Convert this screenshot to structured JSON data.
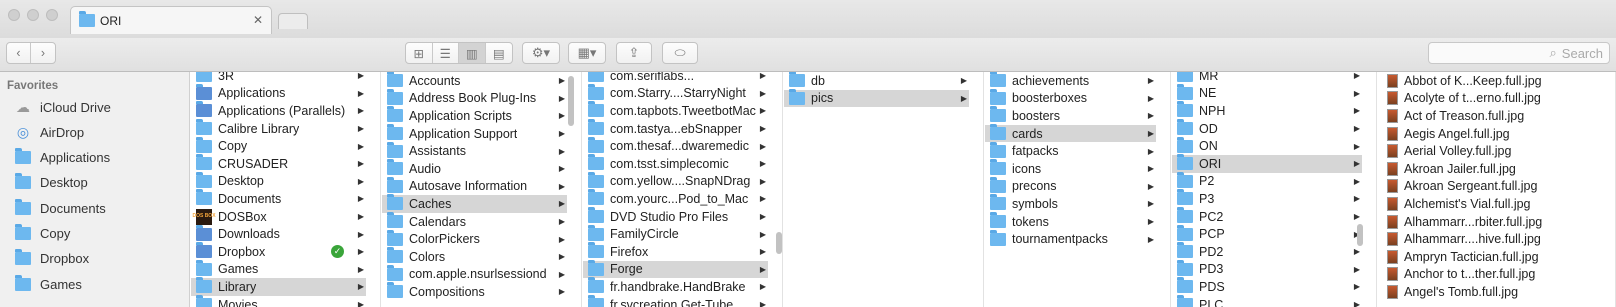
{
  "window": {
    "tab_title": "ORI",
    "tab_close": "✕"
  },
  "toolbar": {
    "search_placeholder": "Search"
  },
  "sidebar": {
    "heading": "Favorites",
    "items": [
      {
        "label": "iCloud Drive",
        "icon": "cloud-icon"
      },
      {
        "label": "AirDrop",
        "icon": "airdrop-icon"
      },
      {
        "label": "Applications",
        "icon": "applications-folder-icon"
      },
      {
        "label": "Desktop",
        "icon": "desktop-folder-icon"
      },
      {
        "label": "Documents",
        "icon": "documents-folder-icon"
      },
      {
        "label": "Copy",
        "icon": "folder-icon"
      },
      {
        "label": "Dropbox",
        "icon": "dropbox-folder-icon"
      },
      {
        "label": "Games",
        "icon": "folder-icon"
      }
    ]
  },
  "columns": [
    {
      "name": "home",
      "items": [
        "3R",
        "Applications",
        "Applications (Parallels)",
        "Calibre Library",
        "Copy",
        "CRUSADER",
        "Desktop",
        "Documents",
        "DOSBox",
        "Downloads",
        "Dropbox",
        "Games",
        "Library",
        "Movies"
      ],
      "selected": "Library"
    },
    {
      "name": "library",
      "items": [
        "Accounts",
        "Address Book Plug-Ins",
        "Application Scripts",
        "Application Support",
        "Assistants",
        "Audio",
        "Autosave Information",
        "Caches",
        "Calendars",
        "ColorPickers",
        "Colors",
        "com.apple.nsurlsessiond",
        "Compositions"
      ],
      "selected": "Caches"
    },
    {
      "name": "caches",
      "items": [
        "com.seriflabs...",
        "com.Starry....StarryNight",
        "com.tapbots.TweetbotMac",
        "com.tastya...ebSnapper",
        "com.thesaf...dwaremedic",
        "com.tsst.simplecomic",
        "com.yellow....SnapNDrag",
        "com.yourc...Pod_to_Mac",
        "DVD Studio Pro Files",
        "FamilyCircle",
        "Firefox",
        "Forge",
        "fr.handbrake.HandBrake",
        "fr.svcreation.Get-Tube"
      ],
      "selected": "Forge"
    },
    {
      "name": "forge",
      "items": [
        "db",
        "pics"
      ],
      "selected": "pics"
    },
    {
      "name": "pics",
      "items": [
        "achievements",
        "boosterboxes",
        "boosters",
        "cards",
        "fatpacks",
        "icons",
        "precons",
        "symbols",
        "tokens",
        "tournamentpacks"
      ],
      "selected": "cards"
    },
    {
      "name": "cards",
      "items": [
        "MR",
        "NE",
        "NPH",
        "OD",
        "ON",
        "ORI",
        "P2",
        "P3",
        "PC2",
        "PCP",
        "PD2",
        "PD3",
        "PDS",
        "PLC"
      ],
      "selected": "ORI"
    },
    {
      "name": "ori",
      "items": [
        "Abbot of K...Keep.full.jpg",
        "Acolyte of t...erno.full.jpg",
        "Act of Treason.full.jpg",
        "Aegis Angel.full.jpg",
        "Aerial Volley.full.jpg",
        "Akroan Jailer.full.jpg",
        "Akroan Sergeant.full.jpg",
        "Alchemist's Vial.full.jpg",
        "Alhammarr...rbiter.full.jpg",
        "Alhammarr....hive.full.jpg",
        "Ampryn Tactician.full.jpg",
        "Anchor to t...ther.full.jpg",
        "Angel's Tomb.full.jpg"
      ],
      "selected": ""
    }
  ]
}
